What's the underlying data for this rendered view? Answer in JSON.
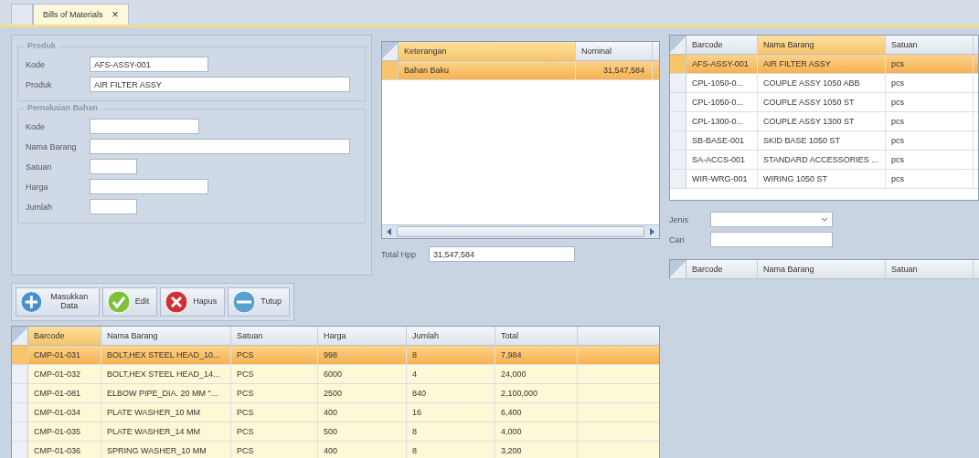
{
  "tabs": [
    {
      "label": "Bills of Materials",
      "close": "×",
      "selected": true
    }
  ],
  "produk": {
    "title": "Produk",
    "fields": [
      {
        "label": "Kode",
        "value": "AFS-ASSY-001"
      },
      {
        "label": "Produk",
        "value": "AIR FILTER ASSY"
      }
    ]
  },
  "pemakaian": {
    "title": "Pemakaian Bahan",
    "fields": [
      {
        "label": "Kode"
      },
      {
        "label": "Nama Barang"
      },
      {
        "label": "Satuan"
      },
      {
        "label": "Harga"
      },
      {
        "label": "Jumlah"
      }
    ]
  },
  "toolbar": [
    {
      "kind": "add",
      "label": "Masukkan Data"
    },
    {
      "kind": "check",
      "label": "Edit"
    },
    {
      "kind": "delete",
      "label": "Hapus"
    },
    {
      "kind": "minus",
      "label": "Tutup"
    }
  ],
  "cost_table": {
    "columns": [
      "Keterangan",
      "Nominal"
    ],
    "rows": [
      {
        "cells": [
          "Bahan Baku",
          "31,547,584"
        ],
        "selected": true
      }
    ]
  },
  "total_hpp": {
    "label": "Total Hpp",
    "value": "31,547,584"
  },
  "product_table": {
    "columns": [
      "Barcode",
      "Nama Barang",
      "Satuan"
    ],
    "rows": [
      {
        "cells": [
          "AFS-ASSY-001",
          "AIR FILTER ASSY",
          "pcs"
        ],
        "selected": true
      },
      {
        "cells": [
          "CPL-1050-0...",
          "COUPLE ASSY 1050 ABB",
          "pcs"
        ],
        "selected": false
      },
      {
        "cells": [
          "CPL-1050-0...",
          "COUPLE ASSY 1050 ST",
          "pcs"
        ],
        "selected": false
      },
      {
        "cells": [
          "CPL-1300-0...",
          "COUPLE ASSY 1300 ST",
          "pcs"
        ],
        "selected": false
      },
      {
        "cells": [
          "SB-BASE-001",
          "SKID BASE 1050 ST",
          "pcs"
        ],
        "selected": false
      },
      {
        "cells": [
          "SA-ACCS-001",
          "STANDARD ACCESSORIES ...",
          "pcs"
        ],
        "selected": false
      },
      {
        "cells": [
          "WIR-WRG-001",
          "WIRING 1050 ST",
          "pcs"
        ],
        "selected": false
      }
    ]
  },
  "filter": {
    "jenis": {
      "label": "Jenis"
    },
    "cari": {
      "label": "Cari"
    }
  },
  "material_table": {
    "columns": [
      "Barcode",
      "Nama Barang",
      "Satuan"
    ]
  },
  "bom_table": {
    "columns": [
      "Barcode",
      "Nama Barang",
      "Satuan",
      "Harga",
      "Jumlah",
      "Total"
    ],
    "rows": [
      {
        "cells": [
          "CMP-01-031",
          "BOLT,HEX STEEL HEAD_10...",
          "PCS",
          "998",
          "8",
          "7,984"
        ],
        "selected": true
      },
      {
        "cells": [
          "CMP-01-032",
          "BOLT,HEX STEEL HEAD_14...",
          "PCS",
          "6000",
          "4",
          "24,000"
        ],
        "selected": false
      },
      {
        "cells": [
          "CMP-01-081",
          "ELBOW PIPE_DIA. 20 MM \"...",
          "PCS",
          "2500",
          "840",
          "2,100,000"
        ],
        "selected": false
      },
      {
        "cells": [
          "CMP-01-034",
          "PLATE WASHER_10 MM",
          "PCS",
          "400",
          "16",
          "6,400"
        ],
        "selected": false
      },
      {
        "cells": [
          "CMP-01-035",
          "PLATE WASHER_14 MM",
          "PCS",
          "500",
          "8",
          "4,000"
        ],
        "selected": false
      },
      {
        "cells": [
          "CMP-01-036",
          "SPRING WASHER_10 MM",
          "PCS",
          "400",
          "8",
          "3,200"
        ],
        "selected": false
      }
    ]
  }
}
